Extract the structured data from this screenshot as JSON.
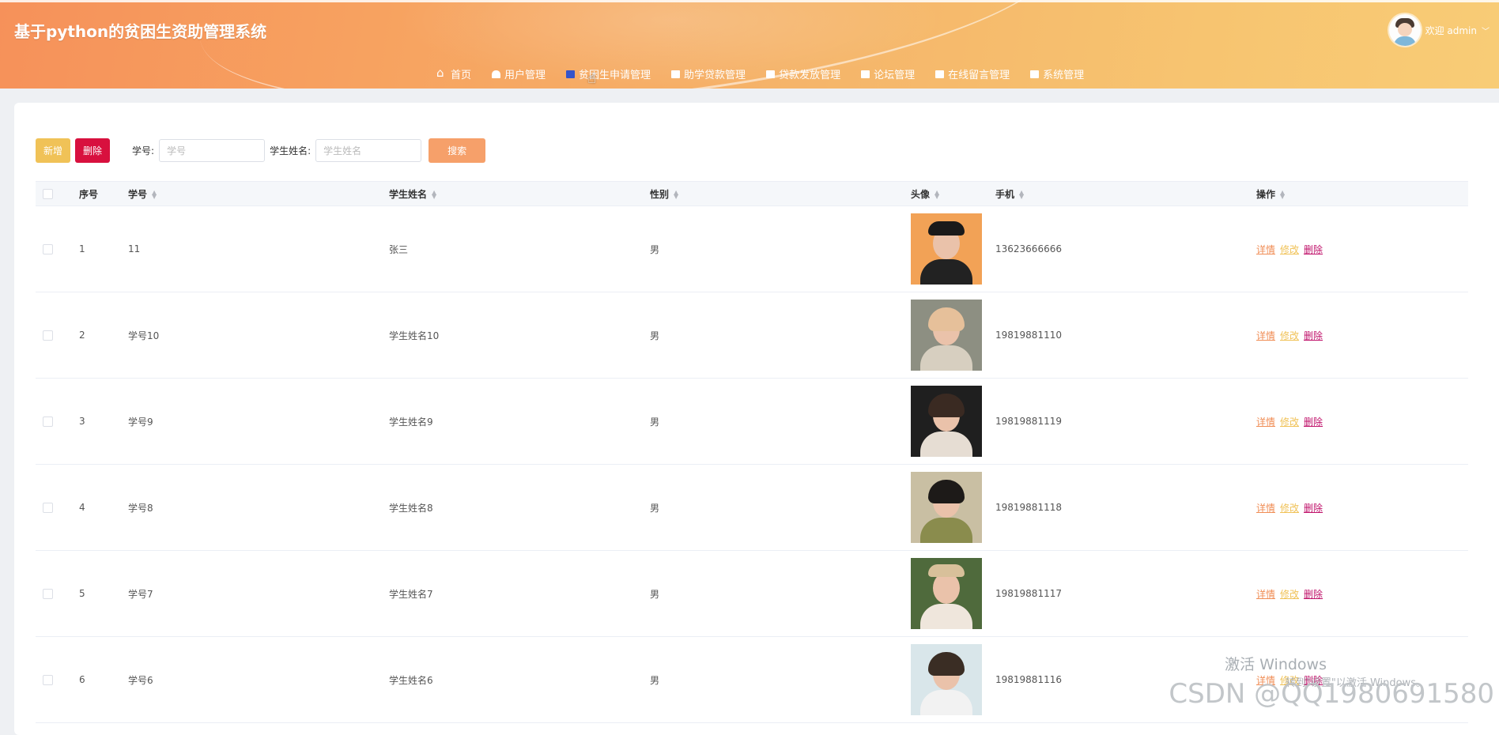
{
  "header": {
    "title": "基于python的贫困生资助管理系统",
    "user_greeting": "欢迎 admin",
    "chevron": "﹀"
  },
  "nav": {
    "items": [
      {
        "label": "首页",
        "icon": "home-icon"
      },
      {
        "label": "用户管理",
        "icon": "lock-icon"
      },
      {
        "label": "贫困生申请管理",
        "icon": "folder-icon"
      },
      {
        "label": "助学贷款管理",
        "icon": "folder-icon"
      },
      {
        "label": "贷款发放管理",
        "icon": "folder-icon"
      },
      {
        "label": "论坛管理",
        "icon": "folder-icon"
      },
      {
        "label": "在线留言管理",
        "icon": "folder-icon"
      },
      {
        "label": "系统管理",
        "icon": "book-icon"
      }
    ]
  },
  "toolbar": {
    "add_label": "新增",
    "delete_label": "删除",
    "student_id_label": "学号:",
    "student_id_placeholder": "学号",
    "student_name_label": "学生姓名:",
    "student_name_placeholder": "学生姓名",
    "search_label": "搜索"
  },
  "table": {
    "headers": {
      "index": "序号",
      "student_id": "学号",
      "student_name": "学生姓名",
      "gender": "性别",
      "avatar": "头像",
      "phone": "手机",
      "actions": "操作"
    },
    "rows": [
      {
        "index": "1",
        "student_id": "11",
        "student_name": "张三",
        "gender": "男",
        "phone": "13623666666"
      },
      {
        "index": "2",
        "student_id": "学号10",
        "student_name": "学生姓名10",
        "gender": "男",
        "phone": "19819881110"
      },
      {
        "index": "3",
        "student_id": "学号9",
        "student_name": "学生姓名9",
        "gender": "男",
        "phone": "19819881119"
      },
      {
        "index": "4",
        "student_id": "学号8",
        "student_name": "学生姓名8",
        "gender": "男",
        "phone": "19819881118"
      },
      {
        "index": "5",
        "student_id": "学号7",
        "student_name": "学生姓名7",
        "gender": "男",
        "phone": "19819881117"
      },
      {
        "index": "6",
        "student_id": "学号6",
        "student_name": "学生姓名6",
        "gender": "男",
        "phone": "19819881116"
      }
    ],
    "actions": {
      "detail": "详情",
      "edit": "修改",
      "delete": "删除"
    }
  },
  "overlay": {
    "windows_activate": "激活 Windows",
    "windows_activate_hint": "转到\"设置\"以激活 Windows。",
    "csdn_watermark": "CSDN @QQ1980691580"
  },
  "colors": {
    "accent_orange": "#f6a06a",
    "add_button": "#f0c257",
    "delete_button": "#d8103e",
    "link_detail": "#f08d55",
    "link_edit": "#f0c257",
    "link_delete": "#c0136b"
  }
}
